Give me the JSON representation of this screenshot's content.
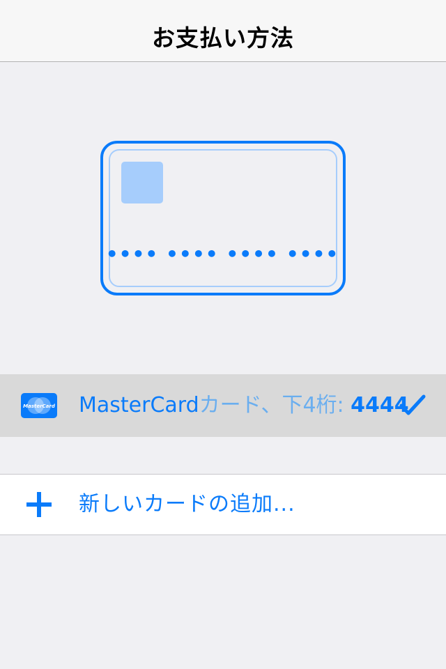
{
  "nav": {
    "title": "お支払い方法"
  },
  "card_illustration": {
    "number_mask": "•••• •••• •••• ••••"
  },
  "saved_card": {
    "brand_icon_text": "MasterCard",
    "brand": "MasterCard",
    "description": "カード、下4桁: ",
    "last4": "4444",
    "selected": true
  },
  "add_card": {
    "label": "新しいカードの追加..."
  },
  "colors": {
    "accent": "#0a7bfa",
    "accent_light": "#a6cdfc",
    "background": "#f0f0f3",
    "selected_row": "#d9d9d9"
  }
}
